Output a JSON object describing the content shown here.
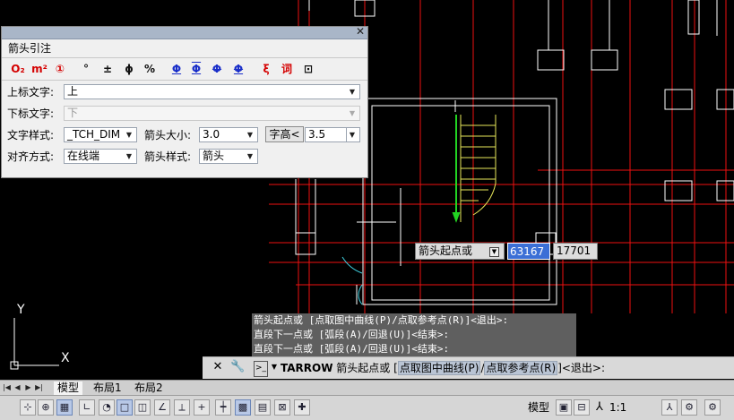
{
  "panel": {
    "title": "箭头引注",
    "close": "✕",
    "symbols": [
      {
        "name": "O2-symbol",
        "text": "O₂",
        "color": "red"
      },
      {
        "name": "m2-symbol",
        "text": "m²",
        "color": "red"
      },
      {
        "name": "circle-1-symbol",
        "text": "①",
        "color": "red"
      },
      {
        "name": "degree-symbol",
        "text": "°",
        "color": "blk"
      },
      {
        "name": "plus-minus-symbol",
        "text": "±",
        "color": "blk"
      },
      {
        "name": "phi-symbol",
        "text": "ϕ",
        "color": "blk"
      },
      {
        "name": "percent-symbol",
        "text": "%",
        "color": "blk"
      },
      {
        "name": "steel-grade-1-symbol",
        "text": "Φ",
        "color": "blue"
      },
      {
        "name": "steel-grade-2-symbol",
        "text": "Φ",
        "color": "blue"
      },
      {
        "name": "steel-grade-3-symbol",
        "text": "Φ",
        "color": "blue"
      },
      {
        "name": "steel-grade-4-symbol",
        "text": "Φ",
        "color": "blue"
      },
      {
        "name": "special-char-symbol",
        "text": "ξ",
        "color": "red"
      },
      {
        "name": "dictionary-symbol",
        "text": "词",
        "color": "red"
      },
      {
        "name": "pick-text-symbol",
        "text": "⊡",
        "color": "blk"
      }
    ],
    "upper_text_label": "上标文字:",
    "upper_text_value": "上",
    "lower_text_label": "下标文字:",
    "lower_text_value": "下",
    "text_style_label": "文字样式:",
    "text_style_value": "_TCH_DIM",
    "arrow_size_label": "箭头大小:",
    "arrow_size_value": "3.0",
    "char_height_button": "字高<",
    "char_height_value": "3.5",
    "align_label": "对齐方式:",
    "align_value": "在线端",
    "arrow_style_label": "箭头样式:",
    "arrow_style_value": "箭头"
  },
  "tooltip": {
    "prompt": "箭头起点或",
    "x_value": "63167",
    "y_value": "17701"
  },
  "history": [
    "箭头起点或 [点取图中曲线(P)/点取参考点(R)]<退出>:",
    "直段下一点或 [弧段(A)/回退(U)]<结束>:",
    "直段下一点或 [弧段(A)/回退(U)]<结束>:"
  ],
  "command": {
    "name": "TARROW",
    "prompt": "箭头起点或",
    "bracket_open": "[",
    "option1": "点取图中曲线(P)",
    "slash": "/",
    "option2": "点取参考点(R)",
    "tail": "]<退出>:"
  },
  "layout_tabs": [
    "模型",
    "布局1",
    "布局2"
  ],
  "status": {
    "model_label": "模型",
    "scale_label": "1:1"
  },
  "ucs": {
    "y_label": "Y",
    "x_label": "X"
  }
}
